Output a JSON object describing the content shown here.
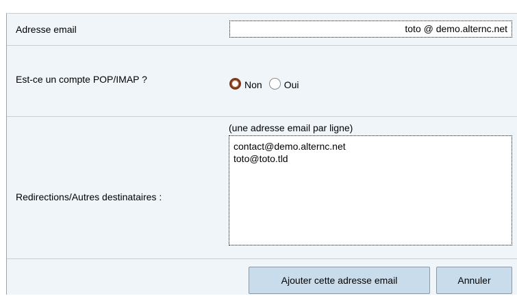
{
  "form": {
    "email_label": "Adresse email",
    "email_value": "toto @ demo.alternc.net",
    "pop_label": "Est-ce un compte POP/IMAP ?",
    "pop_options": [
      {
        "label": "Non",
        "checked": true
      },
      {
        "label": "Oui",
        "checked": false
      }
    ],
    "redirections_label": "Redirections/Autres destinataires :",
    "redirections_hint": "(une adresse email par ligne)",
    "redirections_value": "contact@demo.alternc.net\ntoto@toto.tld",
    "submit_label": "Ajouter cette adresse email",
    "cancel_label": "Annuler"
  },
  "colors": {
    "panel_background": "#f0f5fa",
    "button_background": "#c9dcec",
    "radio_checked": "#7a3a1c"
  }
}
